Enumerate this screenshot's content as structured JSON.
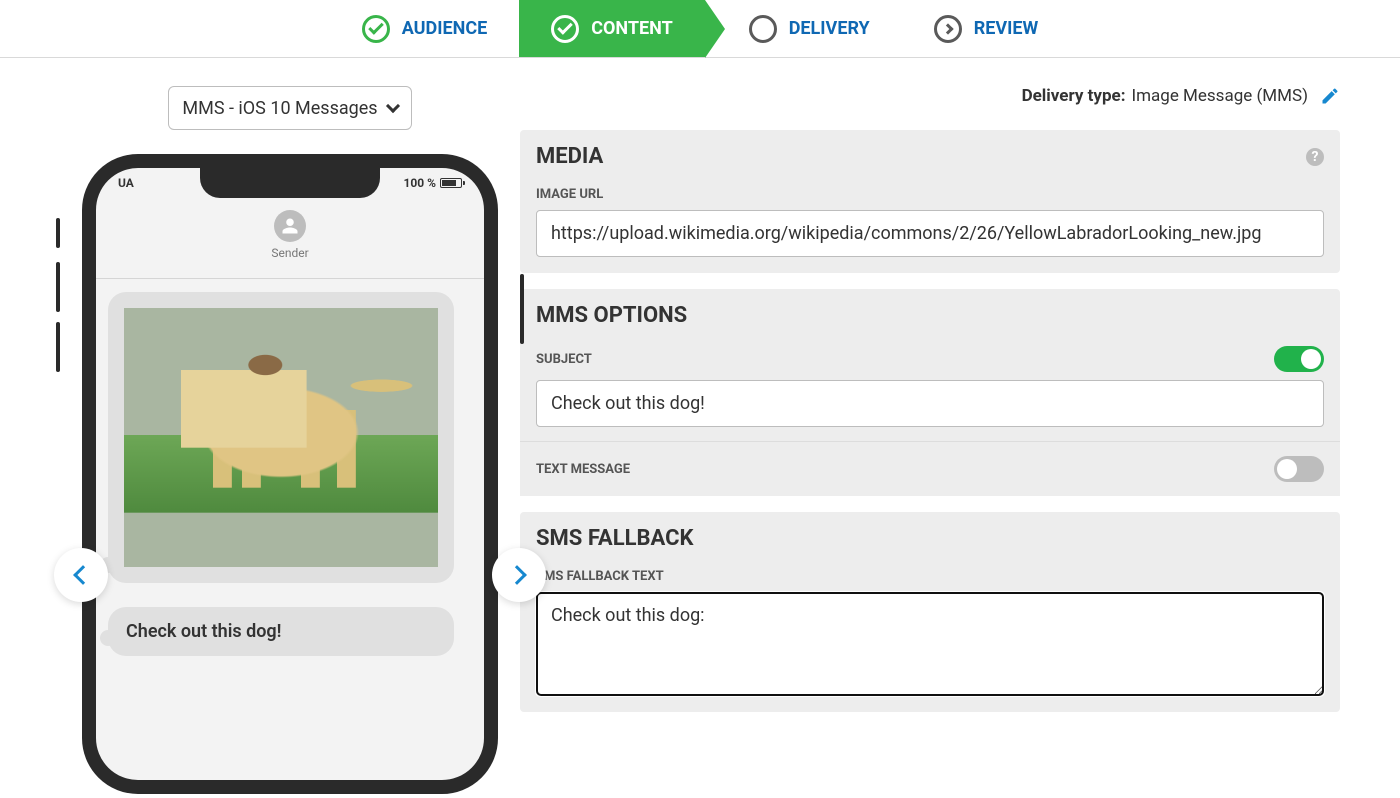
{
  "stepper": {
    "steps": [
      {
        "label": "AUDIENCE",
        "state": "done"
      },
      {
        "label": "CONTENT",
        "state": "active"
      },
      {
        "label": "DELIVERY",
        "state": "pending"
      },
      {
        "label": "REVIEW",
        "state": "review"
      }
    ]
  },
  "preview_selector": {
    "value": "MMS - iOS 10 Messages"
  },
  "delivery_type": {
    "label": "Delivery type:",
    "value": "Image Message (MMS)"
  },
  "phone": {
    "carrier": "UA",
    "battery": "100 %",
    "sender": "Sender",
    "bubble_text": "Check out this dog!"
  },
  "media": {
    "title": "MEDIA",
    "image_url_label": "IMAGE URL",
    "image_url_value": "https://upload.wikimedia.org/wikipedia/commons/2/26/YellowLabradorLooking_new.jpg"
  },
  "mms_options": {
    "title": "MMS OPTIONS",
    "subject_label": "SUBJECT",
    "subject_value": "Check out this dog!",
    "subject_toggle": true,
    "text_message_label": "TEXT MESSAGE",
    "text_message_toggle": false
  },
  "sms_fallback": {
    "title": "SMS FALLBACK",
    "text_label": "SMS FALLBACK TEXT",
    "text_value": "Check out this dog:"
  }
}
